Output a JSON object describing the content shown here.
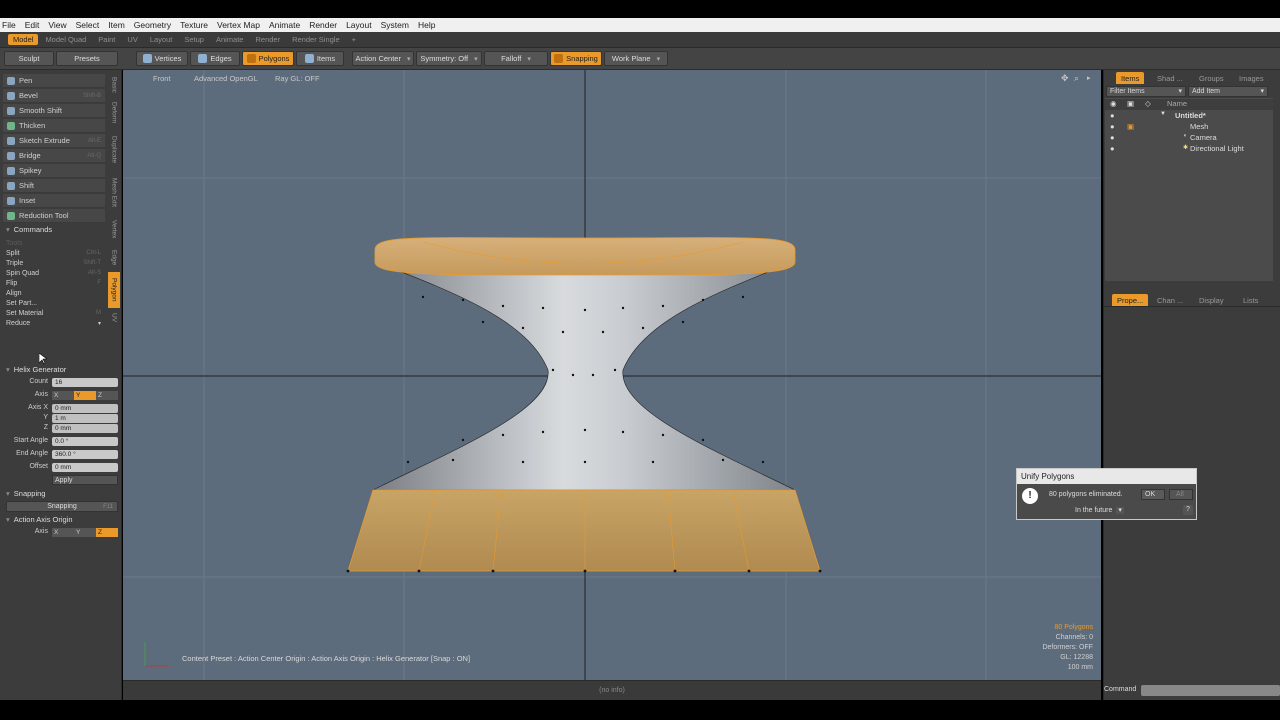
{
  "menu": [
    "File",
    "Edit",
    "View",
    "Select",
    "Item",
    "Geometry",
    "Texture",
    "Vertex Map",
    "Animate",
    "Render",
    "Layout",
    "System",
    "Help"
  ],
  "layout_tabs": [
    {
      "label": "Model",
      "active": true
    },
    {
      "label": "Model Quad",
      "active": false
    },
    {
      "label": "Paint",
      "active": false
    },
    {
      "label": "UV",
      "active": false
    },
    {
      "label": "Layout",
      "active": false
    },
    {
      "label": "Setup",
      "active": false
    },
    {
      "label": "Animate",
      "active": false
    },
    {
      "label": "Render",
      "active": false
    },
    {
      "label": "Render Single",
      "active": false
    },
    {
      "label": "+",
      "active": false
    }
  ],
  "toolbar": {
    "sculpt": "Sculpt",
    "presets": "Presets",
    "vertices": "Vertices",
    "edges": "Edges",
    "polygons": "Polygons",
    "items": "Items",
    "action_center": "Action Center",
    "symmetry": "Symmetry: Off",
    "falloff": "Falloff",
    "snapping": "Snapping",
    "work_plane": "Work Plane"
  },
  "tools": [
    {
      "label": "Pen",
      "shortcut": ""
    },
    {
      "label": "Bevel",
      "shortcut": "Shift-B"
    },
    {
      "label": "Smooth Shift",
      "shortcut": ""
    },
    {
      "label": "Thicken",
      "shortcut": ""
    },
    {
      "label": "Sketch Extrude",
      "shortcut": "Alt-E"
    },
    {
      "label": "Bridge",
      "shortcut": "Alt-Q"
    },
    {
      "label": "Spikey",
      "shortcut": ""
    },
    {
      "label": "Shift",
      "shortcut": ""
    },
    {
      "label": "Inset",
      "shortcut": ""
    },
    {
      "label": "Reduction Tool",
      "shortcut": ""
    }
  ],
  "commands_header": "Commands",
  "commands": [
    {
      "label": "Tools",
      "shortcut": ""
    },
    {
      "label": "Split",
      "shortcut": "Ctrl-L"
    },
    {
      "label": "Triple",
      "shortcut": "Shift-T"
    },
    {
      "label": "Spin Quad",
      "shortcut": "Alt-S"
    },
    {
      "label": "Flip",
      "shortcut": "F"
    },
    {
      "label": "Align",
      "shortcut": ""
    },
    {
      "label": "Set Part...",
      "shortcut": ""
    },
    {
      "label": "Set Material",
      "shortcut": "M"
    },
    {
      "label": "Reduce",
      "shortcut": ""
    }
  ],
  "vtabs": [
    "Basic",
    "Deform",
    "Duplicate",
    "Mesh Edit",
    "Vertex",
    "Edge",
    "Polygon",
    "UV"
  ],
  "helix": {
    "header": "Helix Generator",
    "count_label": "Count",
    "count": "16",
    "axis_label": "Axis",
    "axis_options": [
      "X",
      "Y",
      "Z"
    ],
    "axis_selected": "Y",
    "axisx_label": "Axis X",
    "axisx": "0 mm",
    "y_label": "Y",
    "y": "1 m",
    "z_label": "Z",
    "z": "0 mm",
    "start_label": "Start Angle",
    "start": "0.0 °",
    "end_label": "End Angle",
    "end": "360.0 °",
    "offset_label": "Offset",
    "offset": "0 mm",
    "apply": "Apply"
  },
  "snapping_header": "Snapping",
  "snapping_button": "Snapping",
  "snapping_shortcut": "F11",
  "aao": {
    "header": "Action Axis Origin",
    "axis_label": "Axis",
    "options": [
      "X",
      "Y",
      "Z"
    ],
    "selected": "Z"
  },
  "viewport": {
    "view": "Front",
    "shading": "Advanced OpenGL",
    "raygl": "Ray GL: OFF",
    "tool_status": "Content Preset : Action Center Origin : Action Axis Origin : Helix Generator  [Snap : ON]",
    "stats": [
      "80 Polygons",
      "Channels: 0",
      "Deformers: OFF",
      "GL: 12288",
      "100 mm"
    ]
  },
  "items_panel": {
    "tabs": [
      "Items",
      "Shad ...",
      "Groups",
      "Images"
    ],
    "filter": "Filter Items",
    "add": "Add Item",
    "name_col": "Name",
    "tree": [
      "Untitled*",
      "Mesh",
      "Camera",
      "Directional Light"
    ]
  },
  "props_tabs": [
    "Prope...",
    "Chan ...",
    "Display",
    "Lists"
  ],
  "dialog": {
    "title": "Unify Polygons",
    "message": "80 polygons eliminated.",
    "ok": "OK",
    "all": "All",
    "future": "In the future",
    "help": "?"
  },
  "status_center": "(no info)",
  "command_label": "Command",
  "colors": {
    "accent": "#e99a2a",
    "viewport_bg": "#5d6c7c"
  }
}
